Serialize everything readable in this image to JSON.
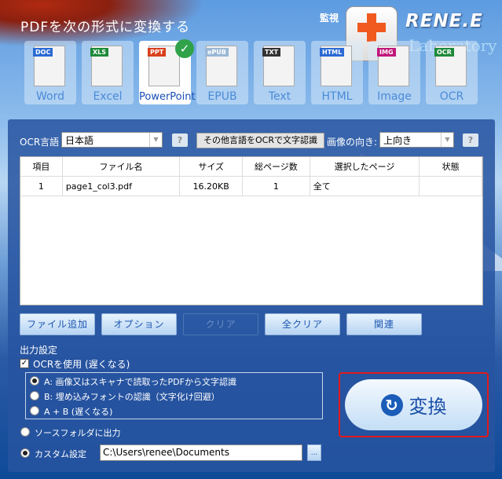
{
  "header": {
    "title": "PDFを次の形式に変換する",
    "monitor_label": "監視",
    "brand": "RENE.E",
    "brand_sub": "Laboratory"
  },
  "formats": [
    {
      "label": "Word",
      "tag": "DOC",
      "color": "#2a6ad4",
      "selected": false
    },
    {
      "label": "Excel",
      "tag": "XLS",
      "color": "#1e8a3a",
      "selected": false
    },
    {
      "label": "PowerPoint",
      "tag": "PPT",
      "color": "#d8401c",
      "selected": true
    },
    {
      "label": "EPUB",
      "tag": "ePUB",
      "color": "#9ab8d6",
      "selected": false
    },
    {
      "label": "Text",
      "tag": "TXT",
      "color": "#333333",
      "selected": false
    },
    {
      "label": "HTML",
      "tag": "HTML",
      "color": "#2a6ad4",
      "selected": false
    },
    {
      "label": "Image",
      "tag": "IMG",
      "color": "#c0187a",
      "selected": false
    },
    {
      "label": "OCR",
      "tag": "OCR",
      "color": "#1e8a3a",
      "selected": false
    }
  ],
  "ocr": {
    "language_label": "OCR言語",
    "language_value": "日本語",
    "other_lang_button": "その他言語をOCRで文字認識",
    "orientation_label": "画像の向き:",
    "orientation_value": "上向き",
    "help": "?"
  },
  "table": {
    "headers": [
      "項目",
      "ファイル名",
      "サイズ",
      "総ページ数",
      "選択したページ",
      "状態"
    ],
    "rows": [
      [
        "1",
        "page1_col3.pdf",
        "16.20KB",
        "1",
        "全て",
        ""
      ]
    ]
  },
  "buttons": {
    "add_file": "ファイル追加",
    "options": "オプション",
    "clear": "クリア",
    "clear_all": "全クリア",
    "related": "関連"
  },
  "output": {
    "label": "出力設定",
    "use_ocr": "OCRを使用 (遅くなる)",
    "use_ocr_checked": true,
    "ocr_modes": [
      "A: 画像又はスキャナで読取ったPDFから文字認識",
      "B: 埋め込みフォントの認識（文字化け回避）",
      "A + B (遅くなる)"
    ],
    "ocr_mode_selected": 0,
    "source_folder": "ソースフォルダに出力",
    "custom": "カスタム設定",
    "custom_selected": true,
    "path": "C:\\Users\\renee\\Documents",
    "browse": "..."
  },
  "convert": {
    "label": "変換"
  }
}
